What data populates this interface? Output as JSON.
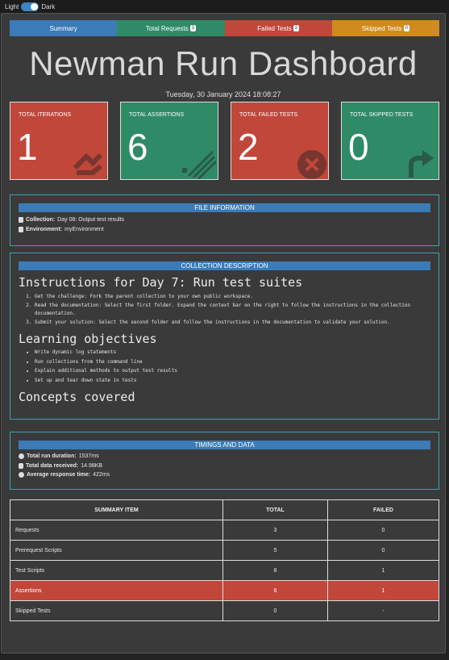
{
  "theme_toggle": {
    "light_label": "Light",
    "dark_label": "Dark"
  },
  "tabs": [
    {
      "label": "Summary",
      "badge": "",
      "color": "#3b7bb7"
    },
    {
      "label": "Total Requests",
      "badge": "3",
      "color": "#2f8a68"
    },
    {
      "label": "Failed Tests",
      "badge": "2",
      "color": "#c0473a"
    },
    {
      "label": "Skipped Tests",
      "badge": "0",
      "color": "#d08a1e"
    }
  ],
  "header": {
    "title": "Newman Run Dashboard",
    "datetime": "Tuesday, 30 January 2024 18:08:27"
  },
  "cards": [
    {
      "label": "TOTAL ITERATIONS",
      "value": "1",
      "color": "#c0473a",
      "icon": "refresh-icon"
    },
    {
      "label": "TOTAL ASSERTIONS",
      "value": "6",
      "color": "#2f8a68",
      "icon": "list-check-icon"
    },
    {
      "label": "TOTAL FAILED TESTS",
      "value": "2",
      "color": "#c0473a",
      "icon": "close-circle-icon"
    },
    {
      "label": "TOTAL SKIPPED TESTS",
      "value": "0",
      "color": "#2f8a68",
      "icon": "skip-arrow-icon"
    }
  ],
  "file_info": {
    "heading": "FILE INFORMATION",
    "collection_label": "Collection:",
    "collection_value": "Day 08: Output test results",
    "environment_label": "Environment:",
    "environment_value": "myEnvironment"
  },
  "collection_description": {
    "heading": "COLLECTION DESCRIPTION",
    "h1": "Instructions for Day 7: Run test suites",
    "steps": [
      "Get the challenge: Fork the parent collection to your own public workspace.",
      "Read the documentation: Select the first folder. Expand the context bar on the right to follow the instructions in the collection documentation.",
      "Submit your solution: Select the second folder and follow the instructions in the documentation to validate your solution."
    ],
    "h2": "Learning objectives",
    "objectives": [
      "Write dynamic log statements",
      "Run collections from the command line",
      "Explain additional methods to output test results",
      "Set up and tear down state in tests"
    ],
    "h3": "Concepts covered"
  },
  "timings": {
    "heading": "TIMINGS AND DATA",
    "duration_label": "Total run duration:",
    "duration_value": "1537ms",
    "data_label": "Total data received:",
    "data_value": "14.98KB",
    "response_label": "Average response time:",
    "response_value": "422ms"
  },
  "summary_table": {
    "headers": [
      "SUMMARY ITEM",
      "TOTAL",
      "FAILED"
    ],
    "rows": [
      {
        "item": "Requests",
        "total": "3",
        "failed": "0"
      },
      {
        "item": "Prerequest Scripts",
        "total": "5",
        "failed": "0"
      },
      {
        "item": "Test Scripts",
        "total": "8",
        "failed": "1"
      },
      {
        "item": "Assertions",
        "total": "6",
        "failed": "1"
      },
      {
        "item": "Skipped Tests",
        "total": "0",
        "failed": "-"
      }
    ]
  }
}
